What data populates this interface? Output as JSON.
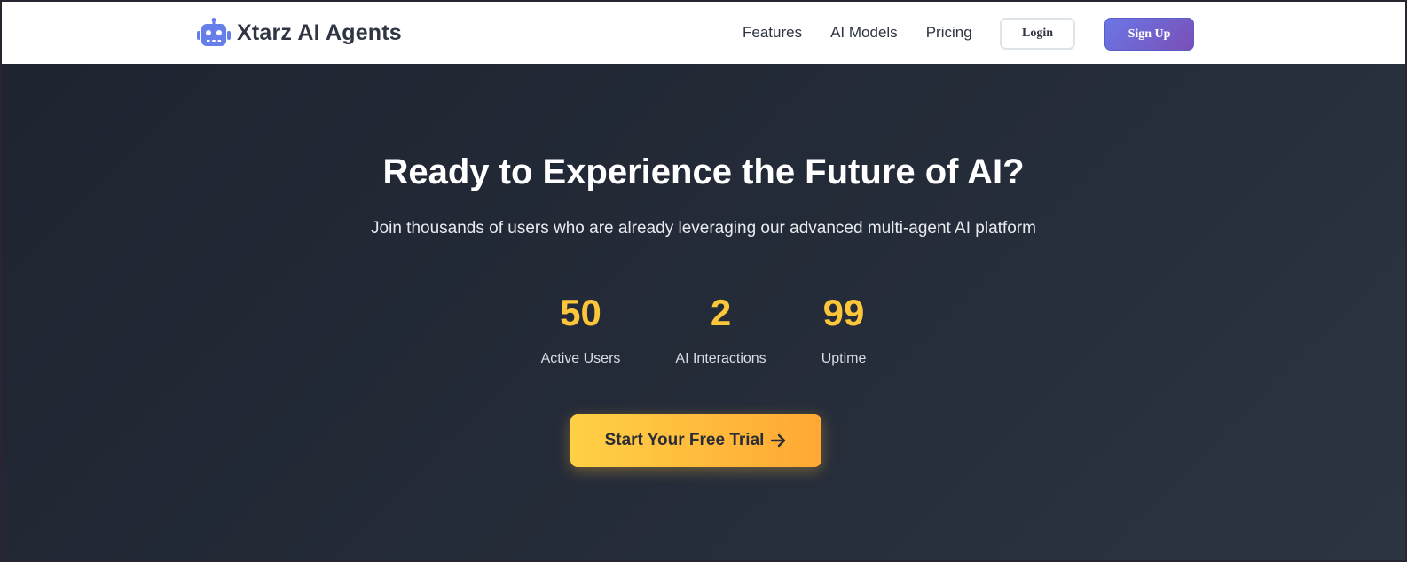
{
  "header": {
    "brand_name": "Xtarz AI Agents",
    "brand_icon": "robot-icon",
    "nav": [
      {
        "label": "Features"
      },
      {
        "label": "AI Models"
      },
      {
        "label": "Pricing"
      }
    ],
    "login_label": "Login",
    "signup_label": "Sign Up"
  },
  "hero": {
    "title": "Ready to Experience the Future of AI?",
    "subtitle": "Join thousands of users who are already leveraging our advanced multi-agent AI platform",
    "stats": [
      {
        "value": "50",
        "label": "Active Users"
      },
      {
        "value": "2",
        "label": "AI Interactions"
      },
      {
        "value": "99",
        "label": "Uptime"
      }
    ],
    "cta_label": "Start Your Free Trial",
    "cta_icon": "arrow-right-icon"
  },
  "colors": {
    "brand_accent": "#667eea",
    "stat_value": "#fcc63a",
    "cta_start": "#ffd046",
    "cta_end": "#ffa834",
    "hero_background": "#232a36"
  }
}
